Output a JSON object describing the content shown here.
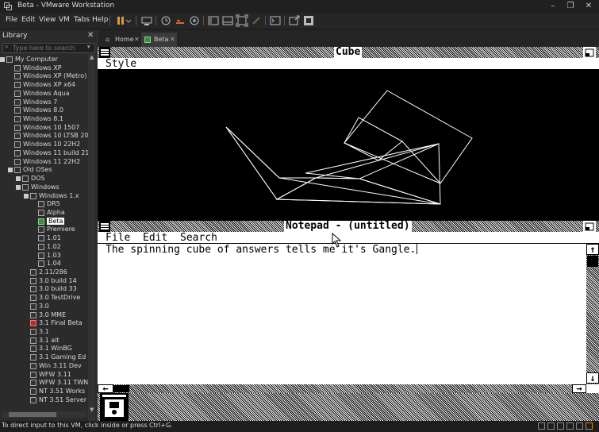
{
  "window": {
    "title": "Beta - VMware Workstation"
  },
  "menu": [
    "File",
    "Edit",
    "View",
    "VM",
    "Tabs",
    "Help"
  ],
  "library": {
    "title": "Library",
    "search_placeholder": "Type here to search",
    "tree": [
      {
        "label": "My Computer",
        "indent": 0,
        "type": "computer",
        "exp": true
      },
      {
        "label": "Windows XP",
        "indent": 1,
        "type": "vm"
      },
      {
        "label": "Windows XP (Metro)",
        "indent": 1,
        "type": "vm"
      },
      {
        "label": "Windows XP x64",
        "indent": 1,
        "type": "vm"
      },
      {
        "label": "Windows Aqua",
        "indent": 1,
        "type": "vm"
      },
      {
        "label": "Windows 7",
        "indent": 1,
        "type": "vm"
      },
      {
        "label": "Windows 8.0",
        "indent": 1,
        "type": "vm"
      },
      {
        "label": "Windows 8.1",
        "indent": 1,
        "type": "vm"
      },
      {
        "label": "Windows 10 1507",
        "indent": 1,
        "type": "vm"
      },
      {
        "label": "Windows 10 LTSB 201",
        "indent": 1,
        "type": "vm"
      },
      {
        "label": "Windows 10 22H2",
        "indent": 1,
        "type": "vm"
      },
      {
        "label": "Windows 11 build 213",
        "indent": 1,
        "type": "vm"
      },
      {
        "label": "Windows 11 22H2",
        "indent": 1,
        "type": "vm"
      },
      {
        "label": "Old OSes",
        "indent": 1,
        "type": "folder",
        "exp": true
      },
      {
        "label": "DOS",
        "indent": 2,
        "type": "folder",
        "exp": true
      },
      {
        "label": "Windows",
        "indent": 2,
        "type": "folder",
        "exp": true
      },
      {
        "label": "Windows 1.x",
        "indent": 3,
        "type": "folder",
        "exp": true
      },
      {
        "label": "DR5",
        "indent": 4,
        "type": "vm"
      },
      {
        "label": "Alpha",
        "indent": 4,
        "type": "vm"
      },
      {
        "label": "Beta",
        "indent": 4,
        "type": "vm-on",
        "selected": true
      },
      {
        "label": "Premiere",
        "indent": 4,
        "type": "vm"
      },
      {
        "label": "1.01",
        "indent": 4,
        "type": "vm"
      },
      {
        "label": "1.02",
        "indent": 4,
        "type": "vm"
      },
      {
        "label": "1.03",
        "indent": 4,
        "type": "vm"
      },
      {
        "label": "1.04",
        "indent": 4,
        "type": "vm"
      },
      {
        "label": "2.11/286",
        "indent": 3,
        "type": "vm"
      },
      {
        "label": "3.0 build 14",
        "indent": 3,
        "type": "vm"
      },
      {
        "label": "3.0 build 33",
        "indent": 3,
        "type": "vm"
      },
      {
        "label": "3.0 TestDrive",
        "indent": 3,
        "type": "vm"
      },
      {
        "label": "3.0",
        "indent": 3,
        "type": "vm"
      },
      {
        "label": "3.0 MME",
        "indent": 3,
        "type": "vm"
      },
      {
        "label": "3.1 Final Beta",
        "indent": 3,
        "type": "vm-red"
      },
      {
        "label": "3.1",
        "indent": 3,
        "type": "vm"
      },
      {
        "label": "3.1 alt",
        "indent": 3,
        "type": "vm"
      },
      {
        "label": "3.1 WinBG",
        "indent": 3,
        "type": "vm"
      },
      {
        "label": "3.1 Gaming Ed",
        "indent": 3,
        "type": "vm"
      },
      {
        "label": "Win 3.11 Dev",
        "indent": 3,
        "type": "vm"
      },
      {
        "label": "WFW 3.11",
        "indent": 3,
        "type": "vm"
      },
      {
        "label": "WFW 3.11 TWN",
        "indent": 3,
        "type": "vm"
      },
      {
        "label": "NT 3.51 Works",
        "indent": 3,
        "type": "vm"
      },
      {
        "label": "NT 3.51 Server",
        "indent": 3,
        "type": "vm"
      }
    ]
  },
  "tabs": [
    {
      "label": "Home",
      "icon": "home-icon"
    },
    {
      "label": "Beta",
      "icon": "vm-tab-icon",
      "active": true
    }
  ],
  "guest": {
    "cube_window": {
      "title": "Cube",
      "menu": "Style"
    },
    "notepad_window": {
      "title": "Notepad - (untitled)",
      "menu": [
        "File",
        "Edit",
        "Search"
      ],
      "text": "The spinning cube of answers tells me it's Gangle."
    }
  },
  "status": {
    "text": "To direct input to this VM, click inside or press Ctrl+G."
  }
}
